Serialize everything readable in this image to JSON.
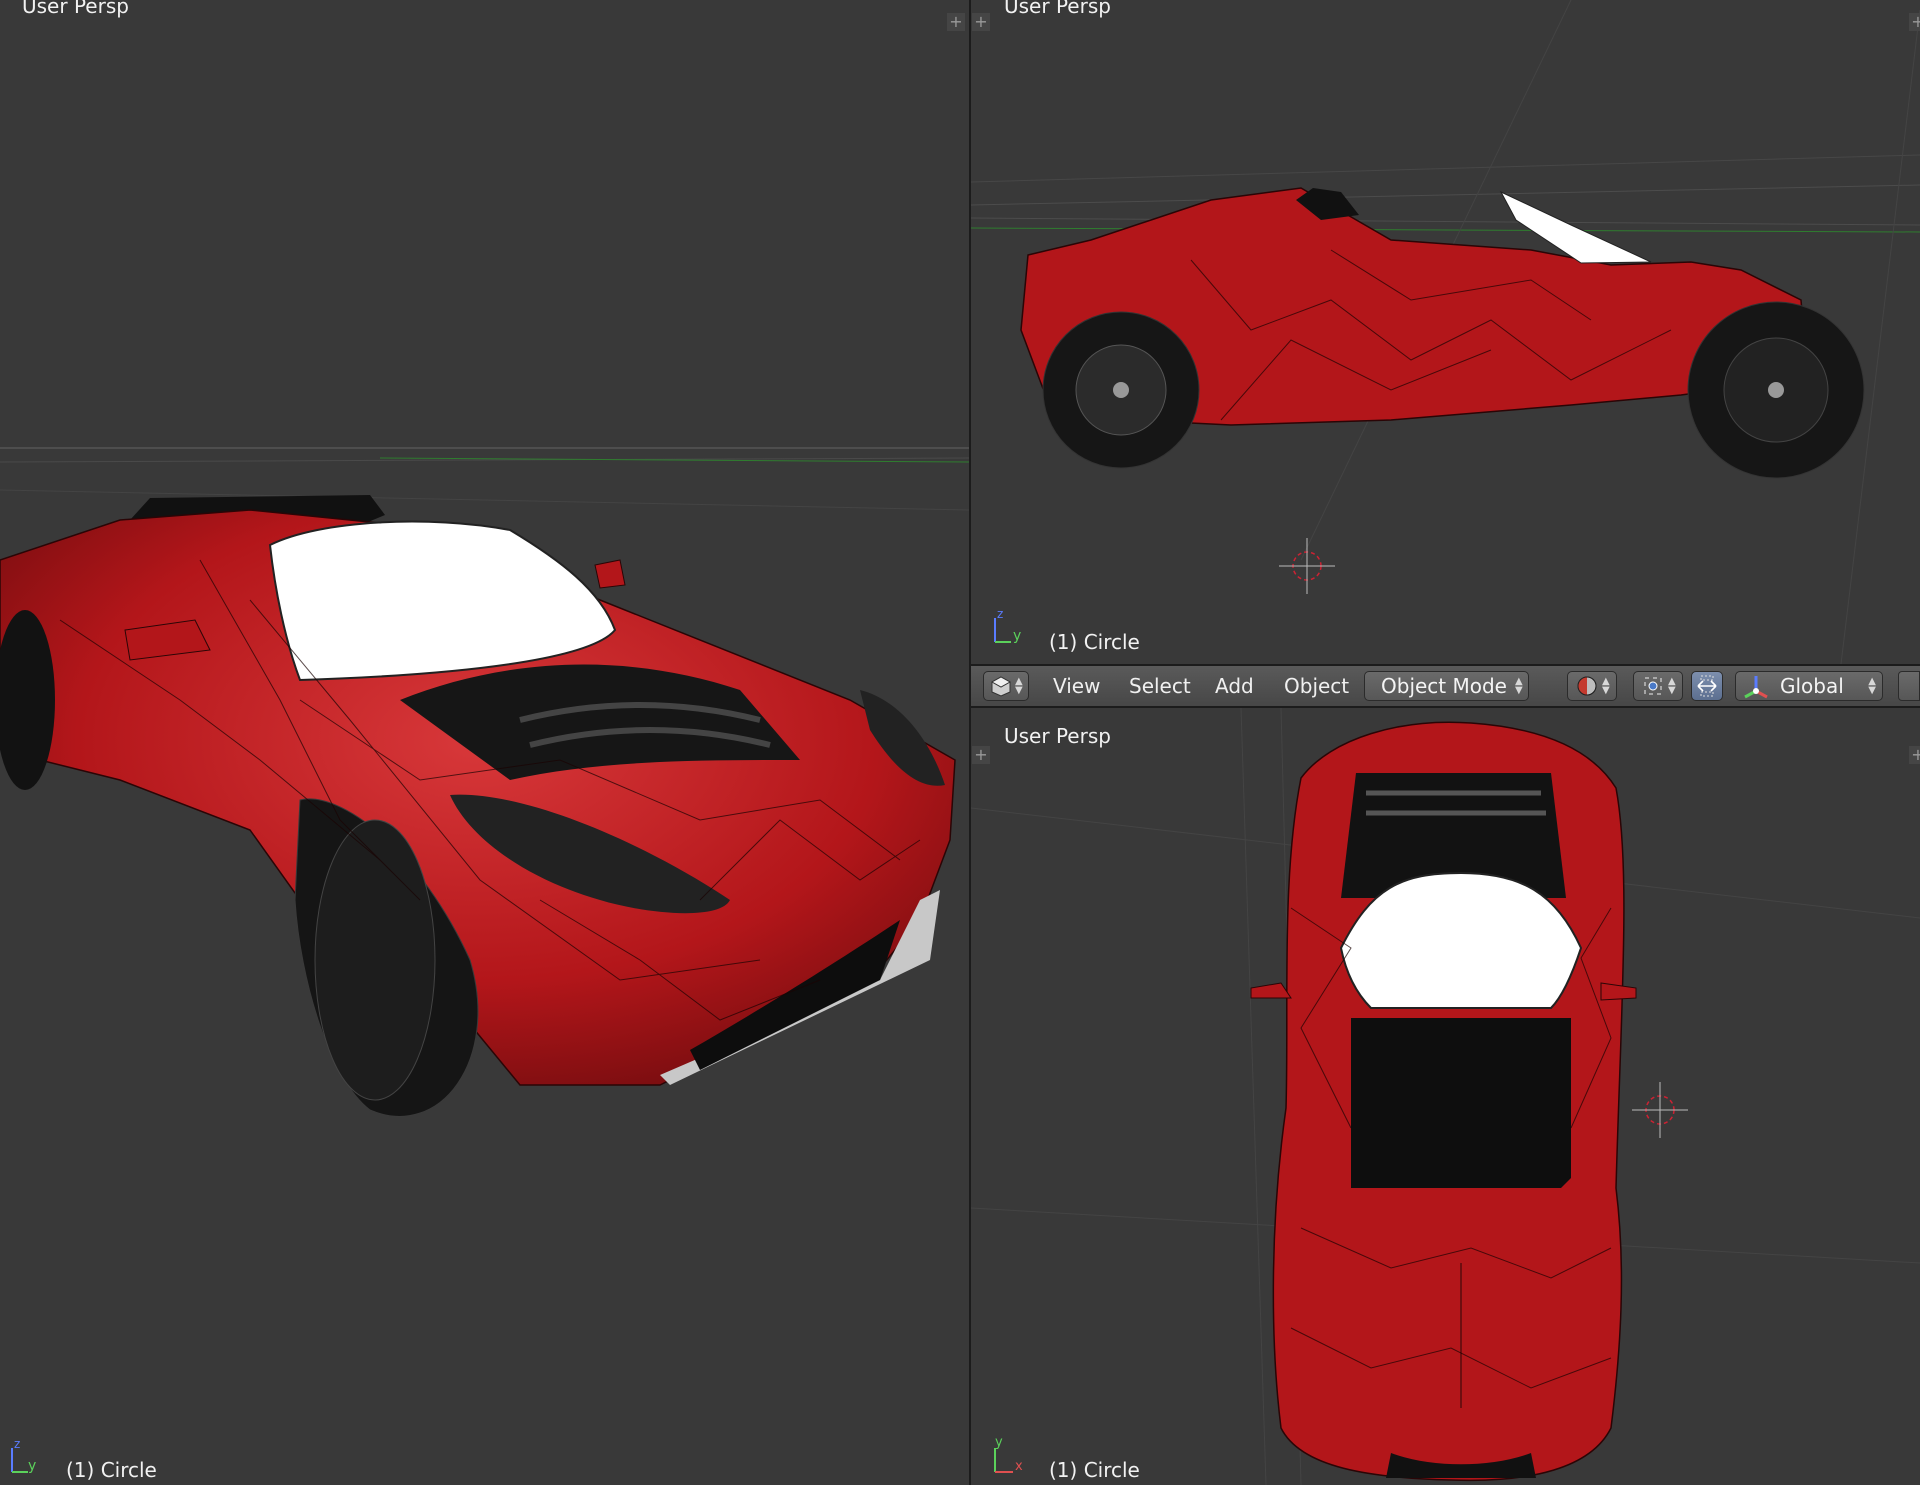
{
  "viewports": {
    "left": {
      "label": "User Persp",
      "object": "(1) Circle",
      "axes": {
        "z": "z",
        "y": "y"
      }
    },
    "top_right": {
      "label": "User Persp",
      "object": "(1) Circle",
      "axes": {
        "z": "z",
        "y": "y"
      }
    },
    "bottom_right": {
      "label": "User Persp",
      "object": "(1) Circle",
      "axes": {
        "y": "y",
        "x": "x"
      }
    }
  },
  "header": {
    "menus": [
      "View",
      "Select",
      "Add",
      "Object"
    ],
    "mode": "Object Mode",
    "orientation": "Global",
    "icons": {
      "editor_type": "cube-icon",
      "mode": "object-mode-icon",
      "shading": "viewport-shading-icon",
      "pivot": "pivot-point-icon",
      "snap": "manipulator-icon",
      "transform": "transform-axes-icon"
    }
  },
  "colors": {
    "background": "#393939",
    "car_body": "#b4161a",
    "accent_axis_x": "#e05050",
    "accent_axis_y": "#5bd15b",
    "accent_axis_z": "#5a7cff"
  }
}
